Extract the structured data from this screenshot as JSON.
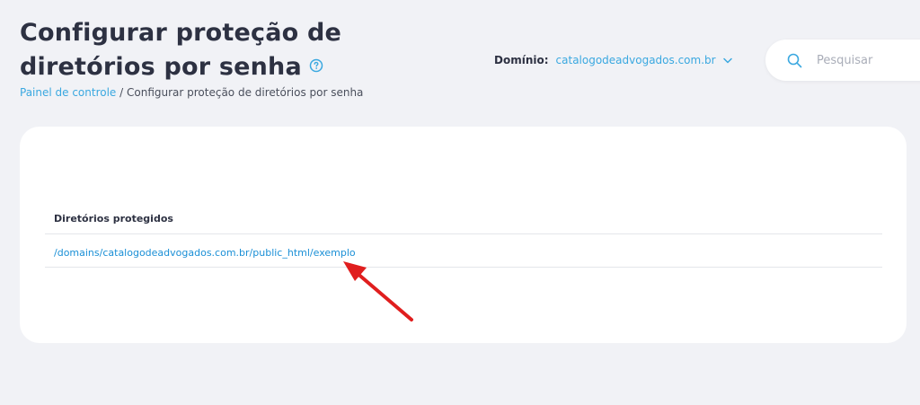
{
  "header": {
    "title": "Configurar proteção de diretórios por senha",
    "help_icon": "question-circle-icon"
  },
  "breadcrumb": {
    "home": "Painel de controle",
    "separator": " / ",
    "current": "Configurar proteção de diretórios por senha"
  },
  "domain": {
    "label": "Domínio:",
    "value": "catalogodeadvogados.com.br"
  },
  "search": {
    "placeholder": "Pesquisar"
  },
  "table": {
    "header": "Diretórios protegidos",
    "rows": [
      "/domains/catalogodeadvogados.com.br/public_html/exemplo"
    ]
  },
  "colors": {
    "accent": "#3aa8e0",
    "link": "#1a8fd6",
    "annotation_arrow": "#e01e1e",
    "background": "#f1f2f6"
  }
}
